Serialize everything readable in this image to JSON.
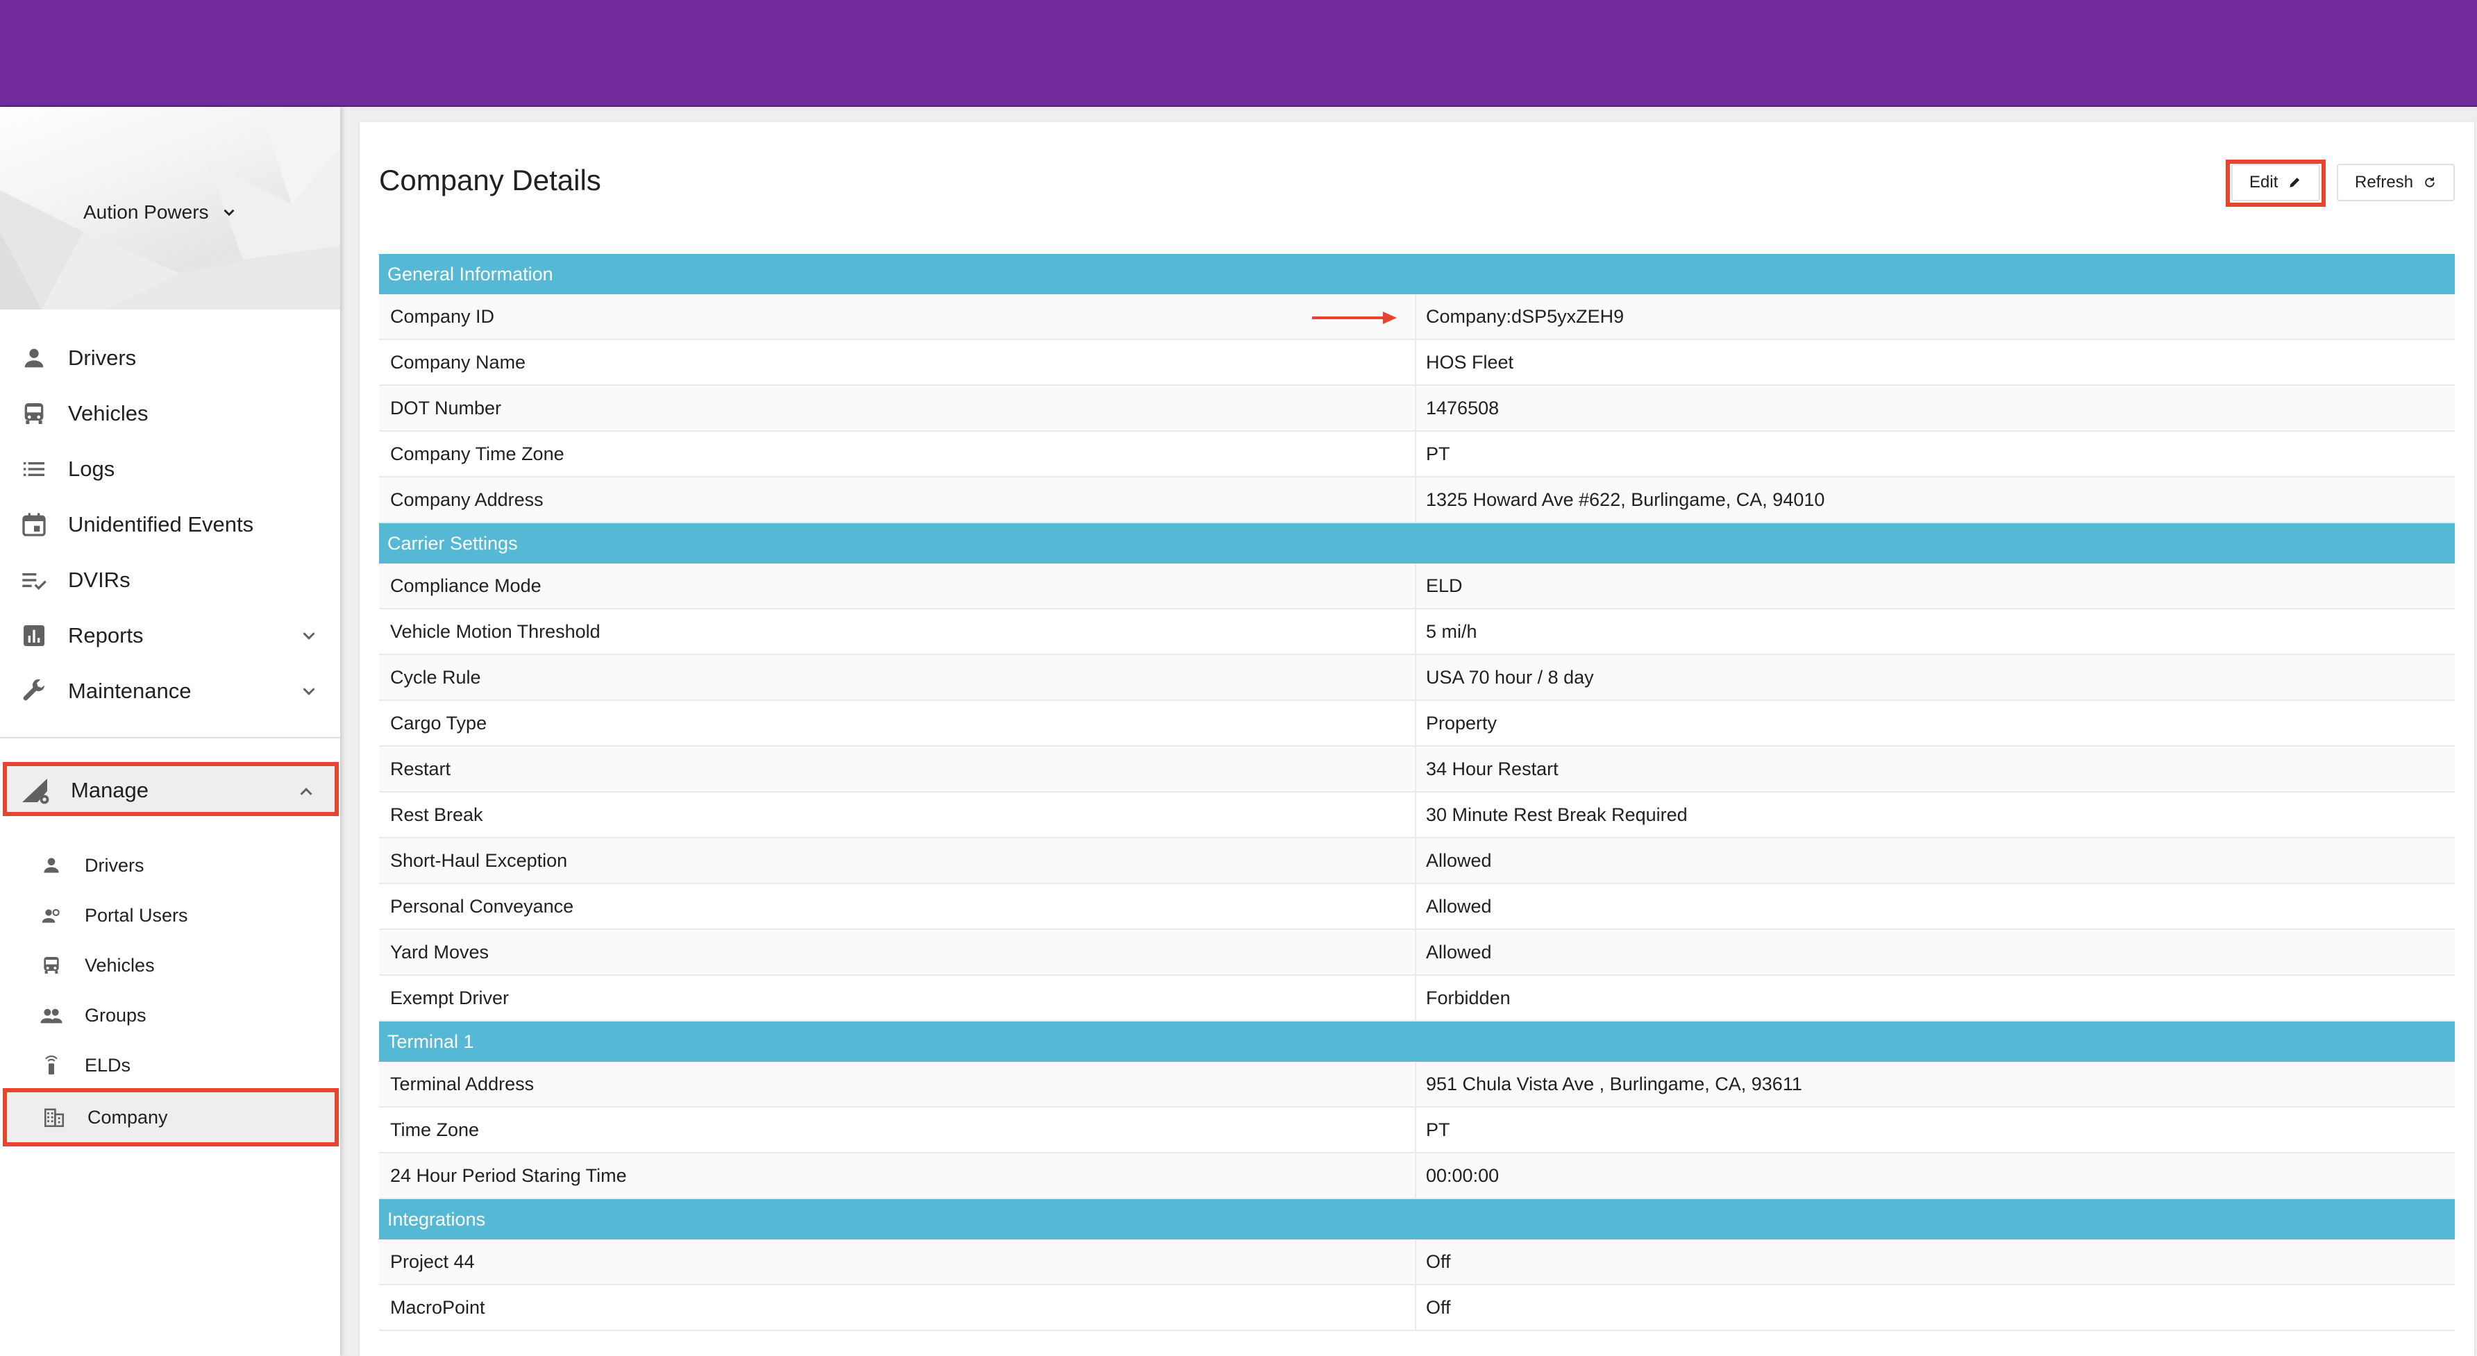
{
  "user": {
    "name": "Aution Powers"
  },
  "nav": {
    "items": [
      {
        "label": "Drivers",
        "icon": "person-icon"
      },
      {
        "label": "Vehicles",
        "icon": "bus-icon"
      },
      {
        "label": "Logs",
        "icon": "list-icon"
      },
      {
        "label": "Unidentified Events",
        "icon": "calendar-icon"
      },
      {
        "label": "DVIRs",
        "icon": "checklist-icon"
      },
      {
        "label": "Reports",
        "icon": "bar-chart-icon"
      },
      {
        "label": "Maintenance",
        "icon": "wrench-icon"
      }
    ],
    "manage": {
      "label": "Manage",
      "items": [
        {
          "label": "Drivers",
          "icon": "person-icon"
        },
        {
          "label": "Portal Users",
          "icon": "portal-users-icon"
        },
        {
          "label": "Vehicles",
          "icon": "bus-icon"
        },
        {
          "label": "Groups",
          "icon": "groups-icon"
        },
        {
          "label": "ELDs",
          "icon": "eld-device-icon"
        },
        {
          "label": "Company",
          "icon": "building-icon"
        }
      ]
    }
  },
  "page": {
    "title": "Company Details",
    "edit_label": "Edit",
    "refresh_label": "Refresh"
  },
  "sections": [
    {
      "title": "General Information",
      "rows": [
        {
          "key": "Company ID",
          "value": "Company:dSP5yxZEH9"
        },
        {
          "key": "Company Name",
          "value": "HOS Fleet"
        },
        {
          "key": "DOT Number",
          "value": "1476508"
        },
        {
          "key": "Company Time Zone",
          "value": "PT"
        },
        {
          "key": "Company Address",
          "value": "1325 Howard Ave #622, Burlingame, CA, 94010"
        }
      ]
    },
    {
      "title": "Carrier Settings",
      "rows": [
        {
          "key": "Compliance Mode",
          "value": "ELD"
        },
        {
          "key": "Vehicle Motion Threshold",
          "value": "5 mi/h"
        },
        {
          "key": "Cycle Rule",
          "value": "USA 70 hour / 8 day"
        },
        {
          "key": "Cargo Type",
          "value": "Property"
        },
        {
          "key": "Restart",
          "value": "34 Hour Restart"
        },
        {
          "key": "Rest Break",
          "value": "30 Minute Rest Break Required"
        },
        {
          "key": "Short-Haul Exception",
          "value": "Allowed"
        },
        {
          "key": "Personal Conveyance",
          "value": "Allowed"
        },
        {
          "key": "Yard Moves",
          "value": "Allowed"
        },
        {
          "key": "Exempt Driver",
          "value": "Forbidden"
        }
      ]
    },
    {
      "title": "Terminal 1",
      "rows": [
        {
          "key": "Terminal Address",
          "value": "951 Chula Vista Ave , Burlingame, CA, 93611"
        },
        {
          "key": "Time Zone",
          "value": "PT"
        },
        {
          "key": "24 Hour Period Staring Time",
          "value": "00:00:00"
        }
      ]
    },
    {
      "title": "Integrations",
      "rows": [
        {
          "key": "Project 44",
          "value": "Off"
        },
        {
          "key": "MacroPoint",
          "value": "Off"
        }
      ]
    }
  ],
  "colors": {
    "topbar": "#722c9c",
    "section_header": "#55b8d4",
    "highlight": "#e8452f"
  }
}
